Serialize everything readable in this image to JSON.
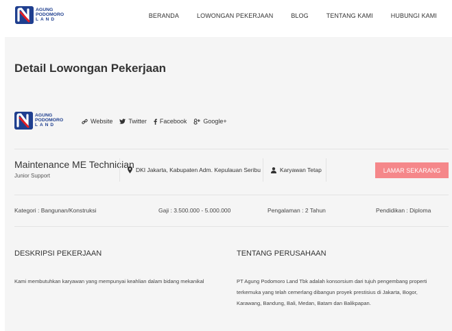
{
  "brand": {
    "name_lines": [
      "AGUNG",
      "PODOMORO",
      "LAND"
    ],
    "color": "#1f3f8f"
  },
  "nav": {
    "items": [
      "BERANDA",
      "LOWONGAN PEKERJAAN",
      "BLOG",
      "TENTANG KAMI",
      "HUBUNGI KAMI"
    ]
  },
  "page": {
    "title": "Detail Lowongan Pekerjaan"
  },
  "company_links": [
    {
      "icon": "link-icon",
      "label": "Website"
    },
    {
      "icon": "twitter-icon",
      "label": "Twitter"
    },
    {
      "icon": "facebook-icon",
      "label": "Facebook"
    },
    {
      "icon": "google-plus-icon",
      "label": "Google+"
    }
  ],
  "job": {
    "title": "Maintenance ME Technician",
    "subtitle": "Junior Support",
    "location": "DKI Jakarta, Kabupaten Adm. Kepulauan Seribu",
    "employment_type": "Karyawan Tetap",
    "apply_label": "LAMAR SEKARANG",
    "apply_color": "#f5878a"
  },
  "details": {
    "category": "Kategori : Bangunan/Konstruksi",
    "salary": "Gaji : 3.500.000 - 5.000.000",
    "experience": "Pengalaman : 2 Tahun",
    "education": "Pendidikan : Diploma"
  },
  "sections": {
    "description_heading": "DESKRIPSI PEKERJAAN",
    "description_text": "Kami membutuhkan karyawan yang mempunyai keahlian dalam bidang mekanikal",
    "company_heading": "TENTANG PERUSAHAAN",
    "company_text_lines": [
      "PT Agung Podomoro Land Tbk adalah konsorsium dari tujuh pengembang properti",
      "terkemuka yang telah cemerlang dibangun proyek prestisius di Jakarta, Bogor,",
      "Karawang, Bandung, Bali, Medan, Batam dan Balikpapan."
    ]
  }
}
